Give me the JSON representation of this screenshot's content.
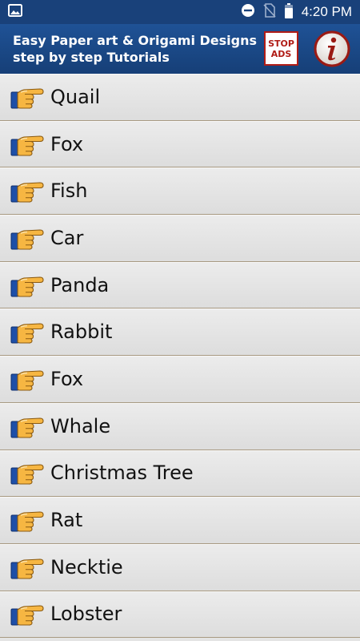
{
  "status_bar": {
    "time": "4:20 PM",
    "icons": [
      "image-icon",
      "do-not-disturb-icon",
      "no-sim-icon",
      "battery-icon"
    ]
  },
  "app_bar": {
    "title_line1": "Easy Paper art & Origami Designs",
    "title_line2": "step by step Tutorials",
    "stop_ads_line1": "STOP",
    "stop_ads_line2": "ADS",
    "info_icon": "info-icon"
  },
  "colors": {
    "header_bg": "#1b4a8a",
    "stop_ads_red": "#b01c16",
    "row_bg": "#e4e4e4",
    "row_divider": "#a89a82",
    "pointer_skin": "#f6b642",
    "pointer_cuff": "#1e4fa8"
  },
  "list": {
    "items": [
      {
        "label": "Quail"
      },
      {
        "label": "Fox"
      },
      {
        "label": "Fish"
      },
      {
        "label": "Car"
      },
      {
        "label": "Panda"
      },
      {
        "label": "Rabbit"
      },
      {
        "label": "Fox"
      },
      {
        "label": "Whale"
      },
      {
        "label": "Christmas Tree"
      },
      {
        "label": "Rat"
      },
      {
        "label": "Necktie"
      },
      {
        "label": "Lobster"
      }
    ],
    "item_icon": "pointing-hand-icon"
  }
}
